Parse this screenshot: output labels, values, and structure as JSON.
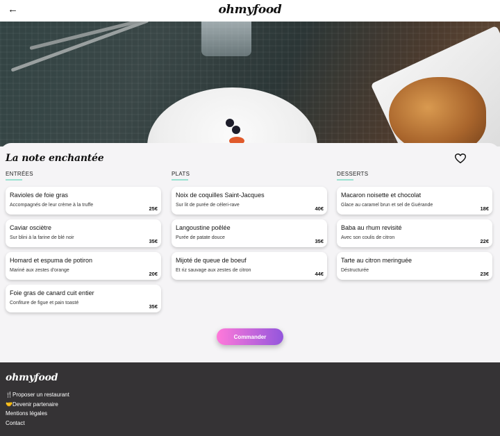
{
  "header": {
    "back_icon": "arrow-left-icon",
    "logo": "ohmyfood"
  },
  "restaurant": {
    "name": "La note enchantée",
    "favorite_icon": "heart-outline-icon"
  },
  "menu": {
    "columns": [
      {
        "title": "ENTRÉES",
        "dishes": [
          {
            "name": "Ravioles de foie gras",
            "description": "Accompagnés de leur crème à la truffe",
            "price": "25€"
          },
          {
            "name": "Caviar osciètre",
            "description": "Sur blini à la farine de blé noir",
            "price": "35€"
          },
          {
            "name": "Homard et espuma de potiron",
            "description": "Mariné aux zestes d'orange",
            "price": "20€"
          },
          {
            "name": "Foie gras de canard cuit entier",
            "description": "Confiture de figue et pain toasté",
            "price": "35€"
          }
        ]
      },
      {
        "title": "PLATS",
        "dishes": [
          {
            "name": "Noix de coquilles Saint-Jacques",
            "description": "Sur lit de purée de céleri-rave",
            "price": "40€"
          },
          {
            "name": "Langoustine poêlée",
            "description": "Purée de patate douce",
            "price": "35€"
          },
          {
            "name": "Mijoté de queue de boeuf",
            "description": "Et riz sauvage aux zestes de citron",
            "price": "44€"
          }
        ]
      },
      {
        "title": "DESSERTS",
        "dishes": [
          {
            "name": "Macaron noisette et chocolat",
            "description": "Glace au caramel brun et sel de Guérande",
            "price": "18€"
          },
          {
            "name": "Baba au rhum revisité",
            "description": "Avec son coulis de citron",
            "price": "22€"
          },
          {
            "name": "Tarte au citron meringuée",
            "description": "Déstructurée",
            "price": "23€"
          }
        ]
      }
    ]
  },
  "order_button": "Commander",
  "footer": {
    "logo": "ohmyfood",
    "links": [
      {
        "icon": "utensils-icon",
        "label": "Proposer un restaurant"
      },
      {
        "icon": "handshake-icon",
        "label": "Devenir partenaire"
      },
      {
        "icon": "",
        "label": "Mentions légales"
      },
      {
        "icon": "",
        "label": "Contact"
      }
    ]
  },
  "colors": {
    "accent_gradient_start": "#ff79da",
    "accent_gradient_end": "#9356dc",
    "section_underline": "#99e2d0",
    "footer_bg": "#353335"
  }
}
